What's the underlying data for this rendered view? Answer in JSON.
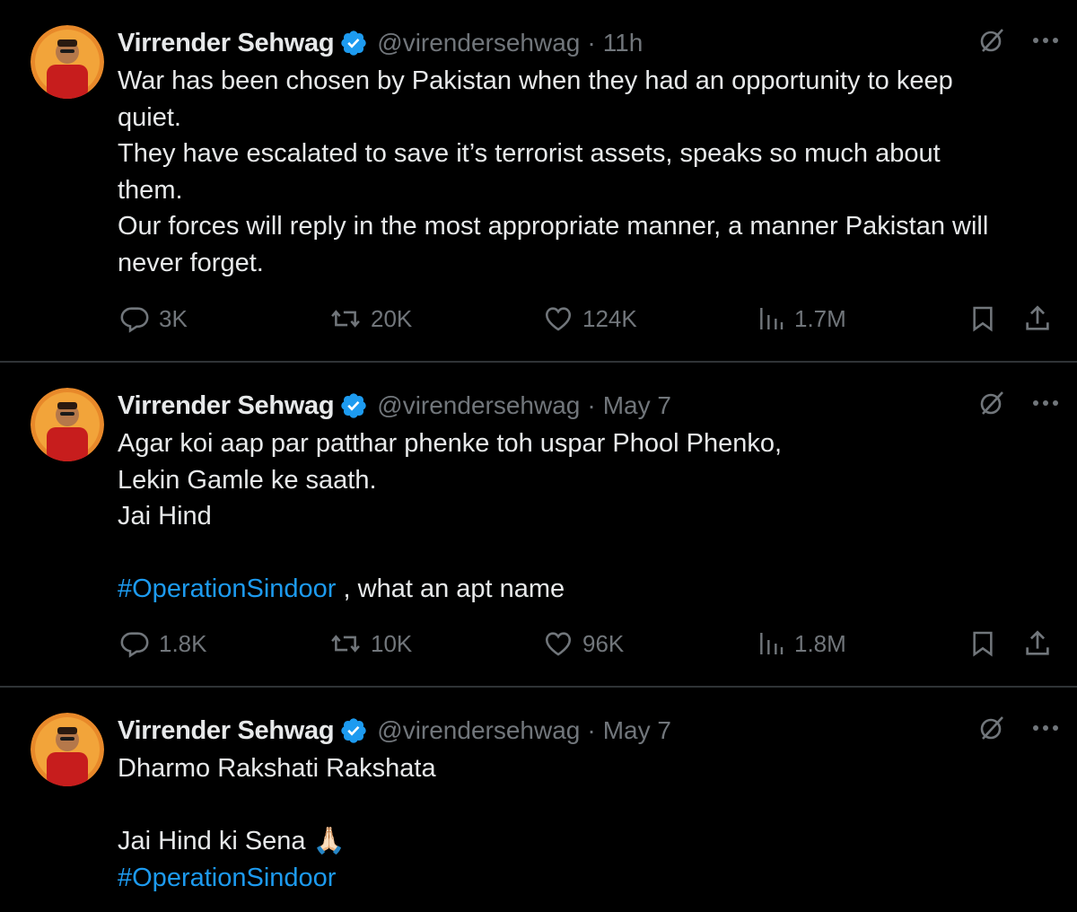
{
  "colors": {
    "background": "#000000",
    "text": "#e7e9ea",
    "muted": "#71767b",
    "link": "#1d9bf0",
    "verified": "#1d9bf0",
    "divider": "#2f3336"
  },
  "tweets": [
    {
      "author": "Virrender Sehwag",
      "handle": "@virendersehwag",
      "separator": "·",
      "time": "11h",
      "lines": [
        "War has been chosen by Pakistan when they had an opportunity to keep",
        "quiet.",
        "They have escalated to save it’s terrorist assets, speaks so much about",
        "them.",
        "Our forces will reply in the most appropriate manner, a manner Pakistan will",
        "never forget."
      ],
      "replies": "3K",
      "reposts": "20K",
      "likes": "124K",
      "views": "1.7M"
    },
    {
      "author": "Virrender Sehwag",
      "handle": "@virendersehwag",
      "separator": "·",
      "time": "May 7",
      "lines": [
        "Agar koi aap par patthar phenke toh uspar Phool Phenko,",
        "Lekin Gamle ke saath.",
        "Jai Hind",
        ""
      ],
      "hashtag": "#OperationSindoor",
      "after_hashtag": " , what an apt name",
      "replies": "1.8K",
      "reposts": "10K",
      "likes": "96K",
      "views": "1.8M"
    },
    {
      "author": "Virrender Sehwag",
      "handle": "@virendersehwag",
      "separator": "·",
      "time": "May 7",
      "lines": [
        "Dharmo Rakshati Rakshata",
        "",
        "Jai Hind ki Sena 🙏🏻"
      ],
      "hashtag": "#OperationSindoor"
    }
  ],
  "icons": {
    "verified": "verified-badge-icon",
    "grok": "grok-icon",
    "more": "more-icon",
    "reply": "reply-icon",
    "repost": "repost-icon",
    "like": "like-icon",
    "views": "views-icon",
    "bookmark": "bookmark-icon",
    "share": "share-icon"
  }
}
